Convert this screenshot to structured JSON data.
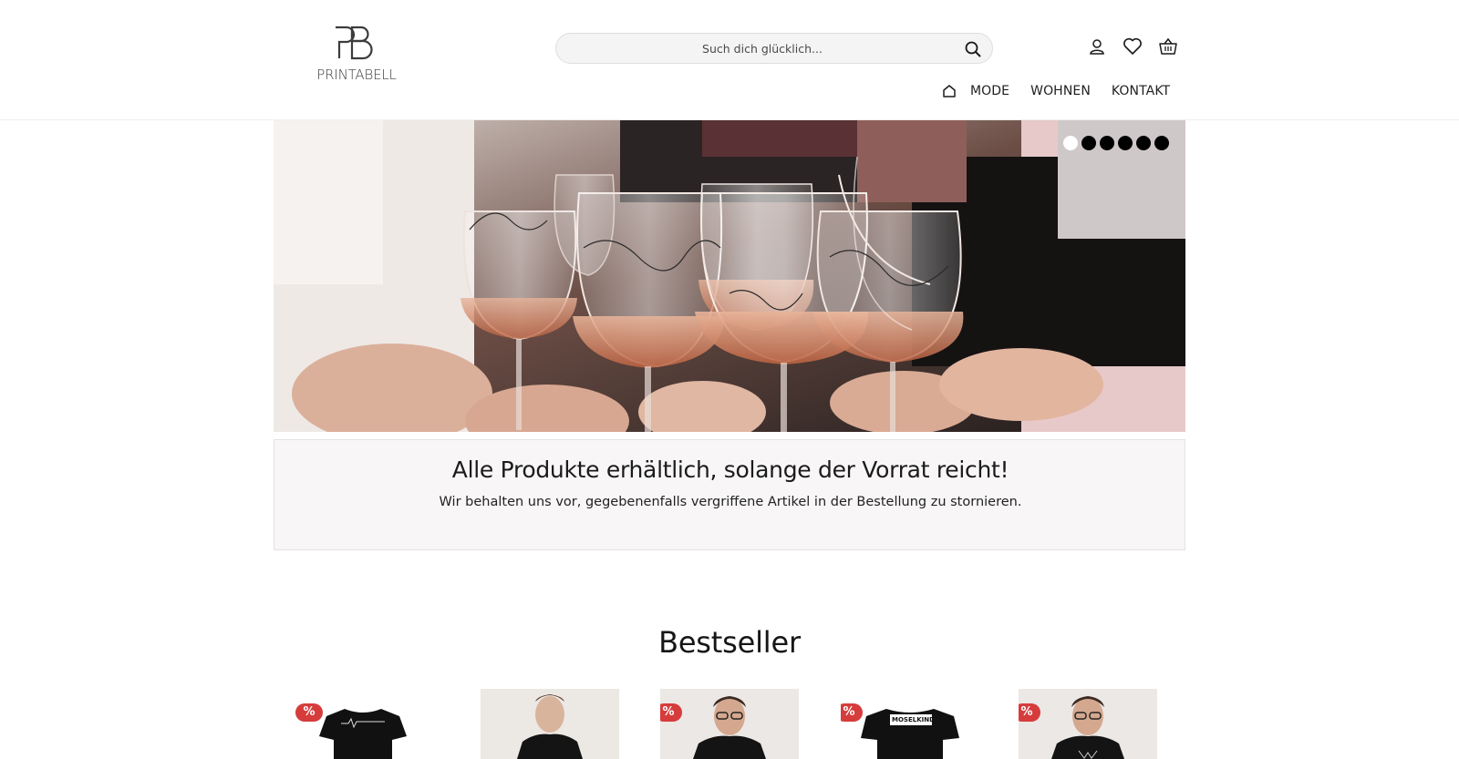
{
  "header": {
    "logo_text": "PRINTABELL",
    "search": {
      "placeholder": "Such dich glücklich..."
    },
    "icons": [
      "account-icon",
      "heart-icon",
      "basket-icon"
    ],
    "nav": {
      "items": [
        "MODE",
        "WOHNEN",
        "KONTAKT"
      ]
    }
  },
  "hero": {
    "slide_count": 6,
    "active_slide": 1
  },
  "notice": {
    "title": "Alle Produkte erhältlich, solange der Vorrat reicht!",
    "text": "Wir behalten uns vor, gegebenenfalls vergriffene Artikel in der Bestellung zu stornieren."
  },
  "bestseller": {
    "title": "Bestseller",
    "products": [
      {
        "badge": "%",
        "shirt_print": ""
      },
      {
        "badge": "",
        "shirt_print": ""
      },
      {
        "badge": "%",
        "shirt_print": ""
      },
      {
        "badge": "%",
        "shirt_print": "MOSELKIND"
      },
      {
        "badge": "%",
        "shirt_print": ""
      }
    ]
  },
  "colors": {
    "badge": "#d63c3c",
    "notice_bg": "#f8f6f6",
    "text": "#1a1a1a"
  }
}
